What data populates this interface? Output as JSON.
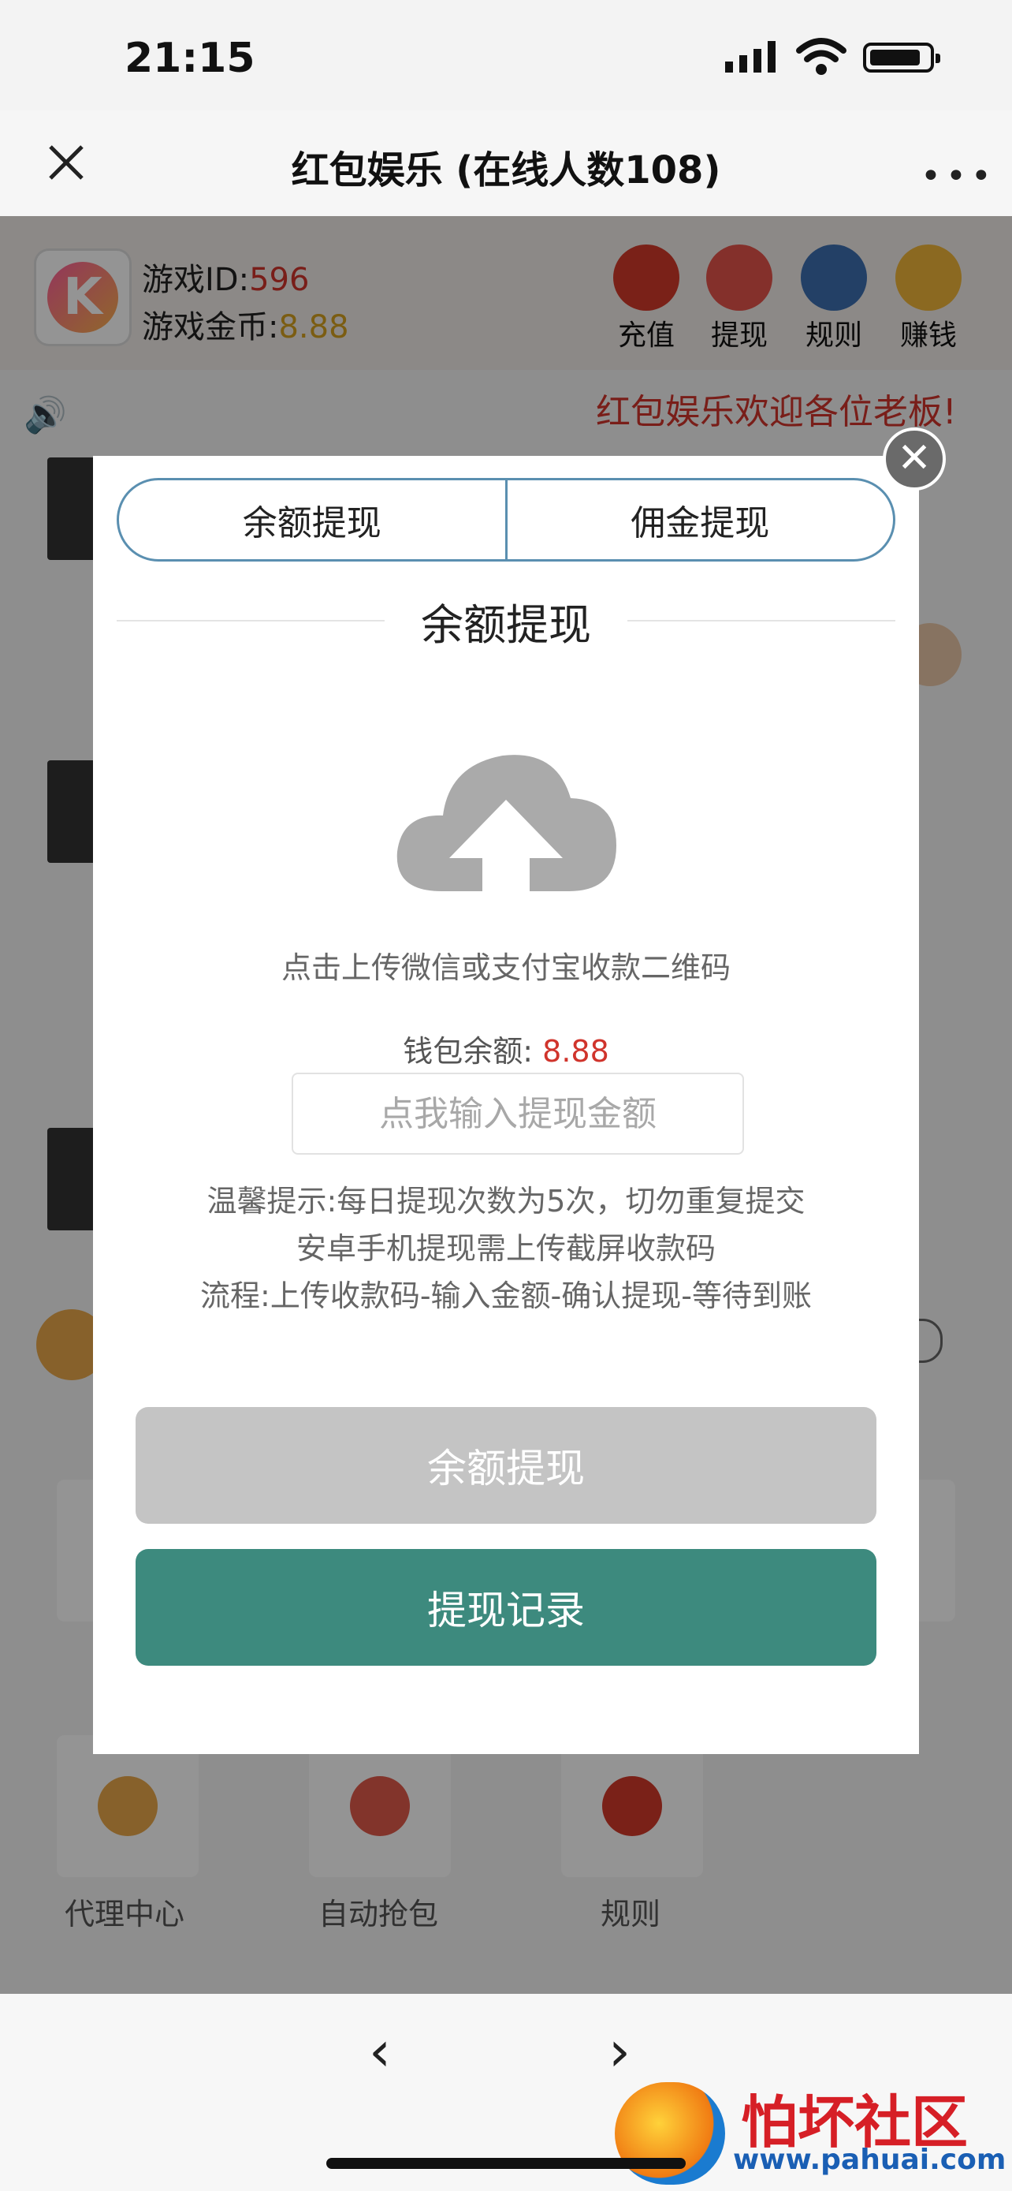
{
  "status": {
    "time": "21:15"
  },
  "nav": {
    "title": "红包娱乐 (在线人数108)"
  },
  "game": {
    "id_label": "游戏ID:",
    "id_value": "596",
    "coin_label": "游戏金币:",
    "coin_value": "8.88",
    "toolbar": [
      "充值",
      "提现",
      "规则",
      "赚钱"
    ],
    "welcome": "红包娱乐欢迎各位老板!"
  },
  "bottom_menu": [
    "代理中心",
    "自动抢包",
    "规则"
  ],
  "modal": {
    "tabs": [
      "余额提现",
      "佣金提现"
    ],
    "section_title": "余额提现",
    "upload_hint": "点击上传微信或支付宝收款二维码",
    "balance_label": "钱包余额: ",
    "balance_value": "8.88",
    "amount_placeholder": "点我输入提现金额",
    "tip1": "温馨提示:每日提现次数为5次，切勿重复提交",
    "tip2": "安卓手机提现需上传截屏收款码",
    "flow": "流程:上传收款码-输入金额-确认提现-等待到账",
    "withdraw_button": "余额提现",
    "records_button": "提现记录"
  },
  "watermark": {
    "name": "怕坏社区",
    "url": "www.pahuai.com"
  },
  "colors": {
    "accent_green": "#3d8a7e",
    "accent_red": "#d0342c",
    "tab_border": "#5a8fb0"
  }
}
